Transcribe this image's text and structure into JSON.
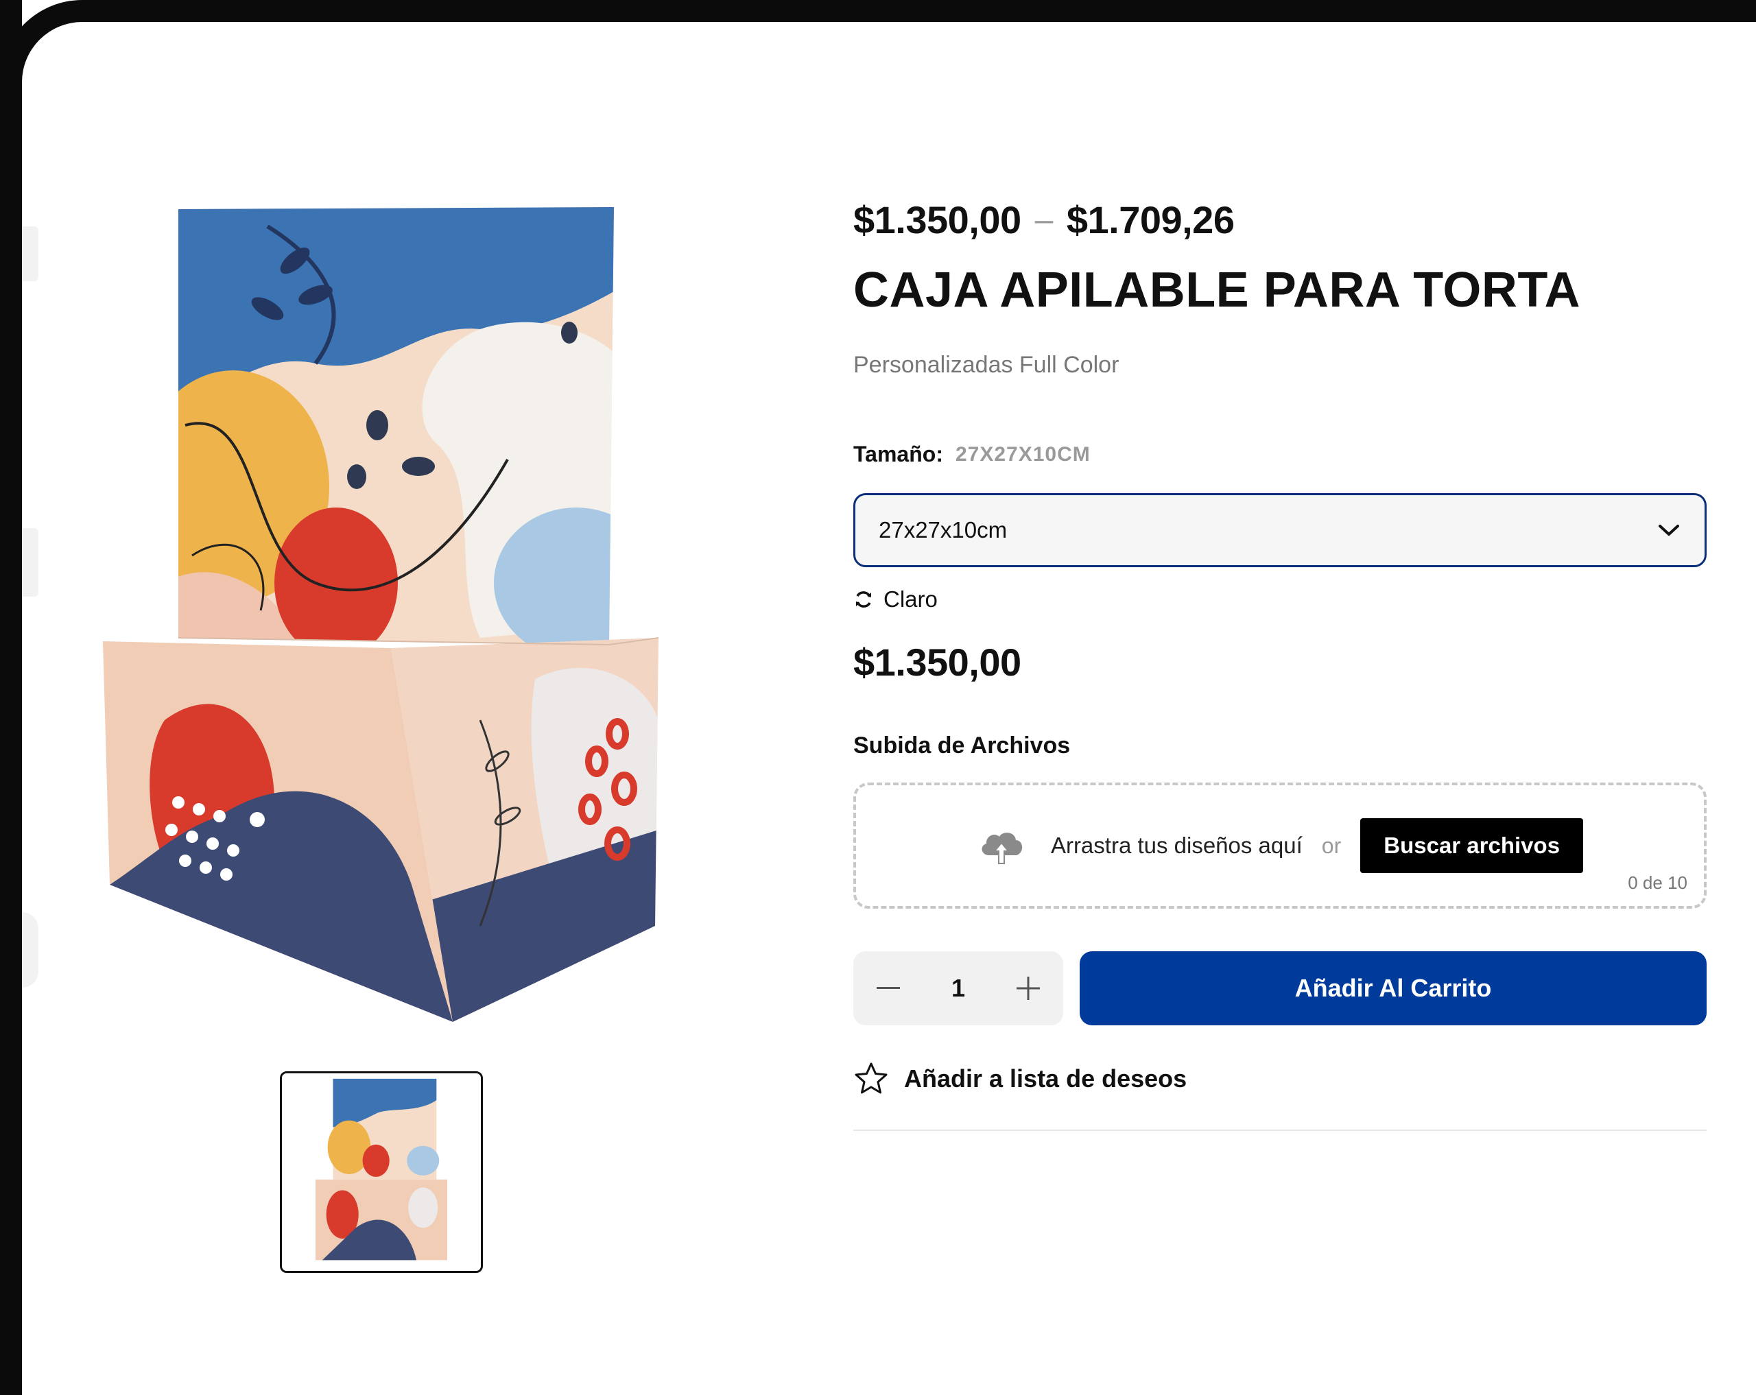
{
  "product": {
    "price_min": "$1.350,00",
    "price_separator": "–",
    "price_max": "$1.709,26",
    "title": "CAJA APILABLE PARA TORTA",
    "subtitle": "Personalizadas Full Color",
    "current_price": "$1.350,00"
  },
  "size": {
    "label": "Tamaño:",
    "selected_label": "27X27X10CM",
    "select_value": "27x27x10cm"
  },
  "variant": {
    "label": "Claro",
    "icon": "refresh-icon"
  },
  "upload": {
    "title": "Subida de Archivos",
    "drop_text": "Arrastra tus diseños aquí",
    "or_text": "or",
    "browse_label": "Buscar archivos",
    "count_text": "0 de 10",
    "icon": "cloud-upload-icon"
  },
  "cart": {
    "quantity": "1",
    "add_label": "Añadir Al Carrito",
    "accent_color": "#003a9b"
  },
  "wishlist": {
    "label": "Añadir a lista de deseos",
    "icon": "star-outline-icon"
  }
}
